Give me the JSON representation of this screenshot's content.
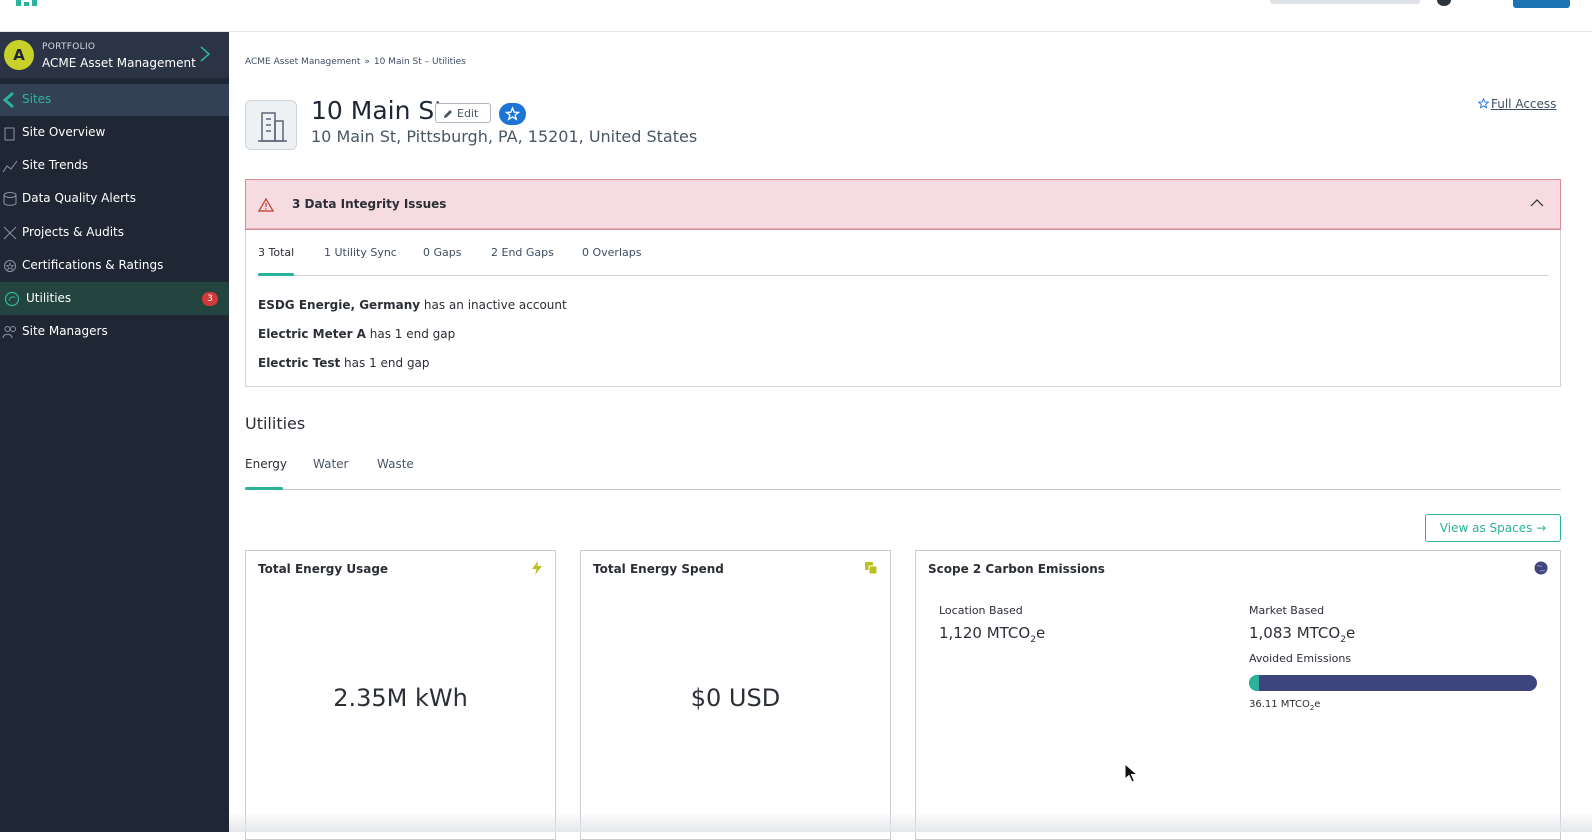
{
  "sidebar": {
    "portfolio": {
      "avatar_letter": "A",
      "label": "PORTFOLIO",
      "name": "ACME Asset Management"
    },
    "sites_label": "Sites",
    "items": [
      {
        "label": "Site Overview"
      },
      {
        "label": "Site Trends"
      },
      {
        "label": "Data Quality Alerts"
      },
      {
        "label": "Projects & Audits"
      },
      {
        "label": "Certifications & Ratings"
      },
      {
        "label": "Utilities",
        "badge": "3",
        "active": true
      },
      {
        "label": "Site Managers"
      }
    ]
  },
  "breadcrumb": {
    "parent": "ACME Asset Management",
    "separator": "»",
    "current": "10 Main St – Utilities"
  },
  "site": {
    "title": "10 Main St",
    "edit_label": "Edit",
    "address": "10 Main St, Pittsburgh, PA, 15201, United States",
    "access_label": "Full Access"
  },
  "integrity": {
    "title": "3 Data Integrity Issues",
    "tabs": [
      {
        "label": "3 Total",
        "active": true
      },
      {
        "label": "1 Utility Sync"
      },
      {
        "label": "0 Gaps"
      },
      {
        "label": "2 End Gaps"
      },
      {
        "label": "0 Overlaps"
      }
    ],
    "issues": [
      {
        "subject": "ESDG Energie, Germany",
        "text": " has an inactive account"
      },
      {
        "subject": "Electric Meter A",
        "text": " has 1 end gap"
      },
      {
        "subject": "Electric Test",
        "text": " has 1 end gap"
      }
    ]
  },
  "utilities": {
    "title": "Utilities",
    "tabs": [
      {
        "label": "Energy",
        "active": true
      },
      {
        "label": "Water"
      },
      {
        "label": "Waste"
      }
    ],
    "view_spaces_label": "View as Spaces →",
    "cards": {
      "usage": {
        "title": "Total Energy Usage",
        "value": "2.35M kWh"
      },
      "spend": {
        "title": "Total Energy Spend",
        "value": "$0 USD"
      },
      "emissions": {
        "title": "Scope 2 Carbon Emissions",
        "location_label": "Location Based",
        "location_value": "1,120 MTCO",
        "location_unit_sub": "2",
        "location_unit_suffix": "e",
        "market_label": "Market Based",
        "market_value": "1,083 MTCO",
        "market_unit_sub": "2",
        "market_unit_suffix": "e",
        "avoided_label": "Avoided Emissions",
        "avoided_value": "36.11 MTCO",
        "avoided_unit_sub": "2",
        "avoided_unit_suffix": "e",
        "avoided_fraction": 0.033
      }
    }
  },
  "colors": {
    "sidebar_bg": "#1f2735",
    "accent": "#2bb39a",
    "alert_bg": "#f6dbe0",
    "badge": "#d23a3a",
    "emissions_bar": "#3e447e"
  },
  "icons": {
    "usage": "lightning-icon",
    "spend": "money-icon",
    "emissions": "globe-icon"
  }
}
